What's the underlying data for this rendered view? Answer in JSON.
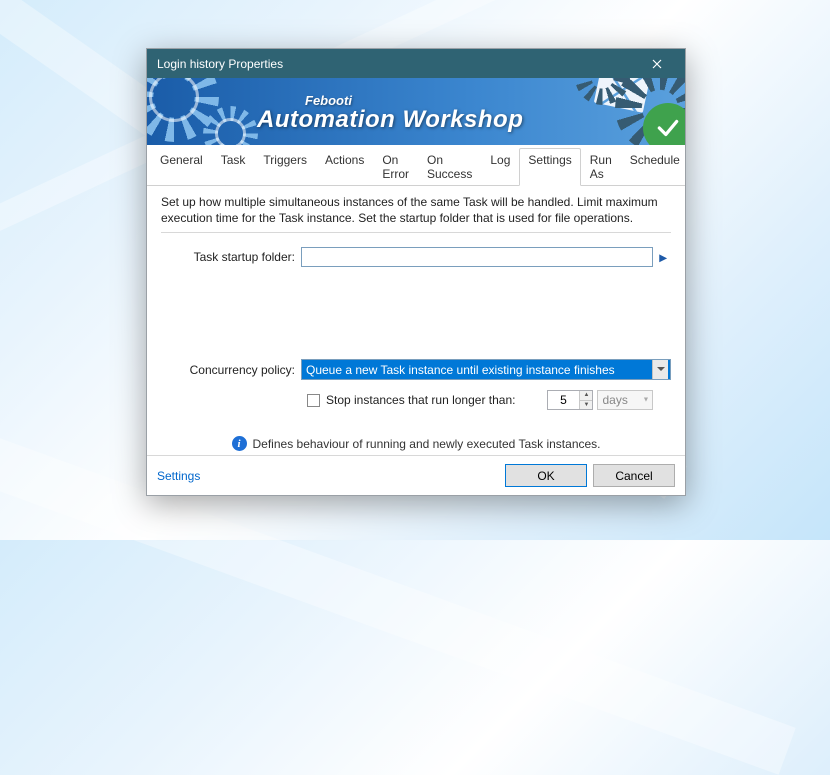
{
  "window": {
    "title": "Login history Properties"
  },
  "banner": {
    "brand_small": "Febooti",
    "brand_big": "Automation Workshop"
  },
  "tabs": [
    {
      "label": "General",
      "active": false
    },
    {
      "label": "Task",
      "active": false
    },
    {
      "label": "Triggers",
      "active": false
    },
    {
      "label": "Actions",
      "active": false
    },
    {
      "label": "On Error",
      "active": false
    },
    {
      "label": "On Success",
      "active": false
    },
    {
      "label": "Log",
      "active": false
    },
    {
      "label": "Settings",
      "active": true
    },
    {
      "label": "Run As",
      "active": false
    },
    {
      "label": "Schedule",
      "active": false
    }
  ],
  "settings": {
    "description": "Set up how multiple simultaneous instances of the same Task will be handled. Limit maximum execution time for the Task instance. Set the startup folder that is used for file operations.",
    "startup_folder_label": "Task startup folder:",
    "startup_folder_value": "",
    "concurrency_label": "Concurrency policy:",
    "concurrency_value": "Queue a new Task instance until existing instance finishes",
    "stop_checkbox_label": "Stop instances that run longer than:",
    "stop_checked": false,
    "stop_value": "5",
    "stop_unit": "days",
    "info_text": "Defines behaviour of running and newly executed Task instances."
  },
  "footer": {
    "help_link": "Settings",
    "ok_label": "OK",
    "cancel_label": "Cancel"
  }
}
